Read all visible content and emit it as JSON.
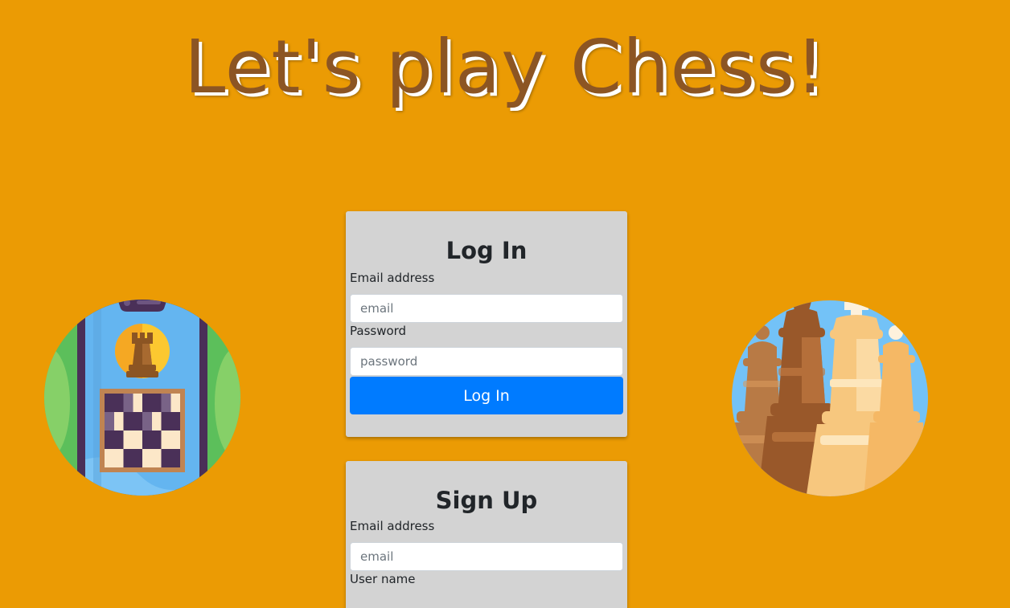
{
  "header": {
    "title": "Let's play Chess!"
  },
  "login": {
    "heading": "Log In",
    "email_label": "Email address",
    "email_placeholder": "email",
    "password_label": "Password",
    "password_placeholder": "password",
    "submit_label": "Log In"
  },
  "signup": {
    "heading": "Sign Up",
    "email_label": "Email address",
    "email_placeholder": "email",
    "username_label": "User name"
  },
  "illustrations": {
    "left": "phone-chessboard-icon",
    "right": "chess-pieces-icon"
  },
  "colors": {
    "background": "#EB9B04",
    "title": "#8C5523",
    "card": "#D3D3D3",
    "primary_button": "#007BFF"
  }
}
